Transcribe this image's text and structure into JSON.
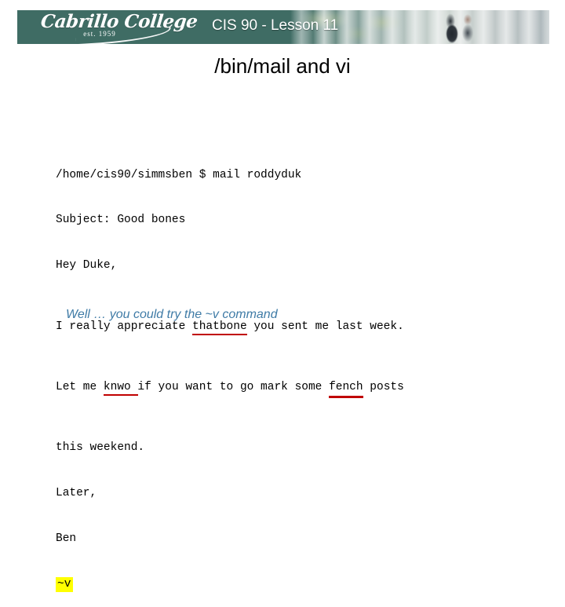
{
  "header": {
    "logo_name": "Cabrillo College",
    "logo_est": "est. 1959",
    "title": "CIS 90 - Lesson 11",
    "teal_color": "#3f6c64"
  },
  "slide": {
    "title": "/bin/mail and vi",
    "caption": "Well … you could try the ~v command",
    "caption_color": "#3f7ba6",
    "misspell_underline_color": "#c00000",
    "highlight_color": "#ffff00"
  },
  "mail": {
    "line1": "/home/cis90/simmsben $ mail roddyduk",
    "line2": "Subject: Good bones",
    "line3": "Hey Duke,",
    "line4_a": "I really appreciate ",
    "line4_b": "thatbone",
    "line4_c": " you sent me last week.",
    "line5_a": "Let me ",
    "line5_b": "knwo",
    "line5_c": " if you want to go mark some ",
    "line5_d": "fench",
    "line5_e": " posts",
    "line6": "this weekend.",
    "line7": "Later,",
    "line8": "Ben",
    "line9": "~v"
  }
}
